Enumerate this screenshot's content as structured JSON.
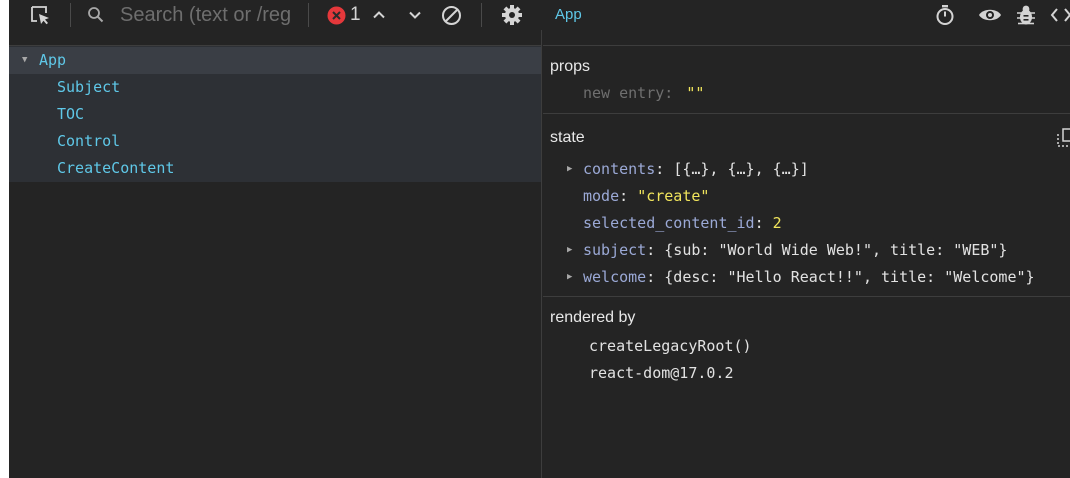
{
  "toolbar": {
    "search_placeholder": "Search (text or /reg",
    "error_count": "1"
  },
  "tree": {
    "items": [
      {
        "label": "App",
        "depth": 0,
        "expanded": true,
        "selected": true
      },
      {
        "label": "Subject",
        "depth": 1
      },
      {
        "label": "TOC",
        "depth": 1
      },
      {
        "label": "Control",
        "depth": 1
      },
      {
        "label": "CreateContent",
        "depth": 1
      }
    ]
  },
  "inspector": {
    "component_name": "App",
    "props": {
      "title": "props",
      "entries": [
        {
          "key": "new entry",
          "value": "\"\""
        }
      ]
    },
    "state": {
      "title": "state",
      "entries": [
        {
          "key": "contents",
          "value": "[{…}, {…}, {…}]",
          "expandable": true
        },
        {
          "key": "mode",
          "value": "\"create\""
        },
        {
          "key": "selected_content_id",
          "value": "2"
        },
        {
          "key": "subject",
          "value": "{sub: \"World Wide Web!\", title: \"WEB\"}",
          "expandable": true
        },
        {
          "key": "welcome",
          "value": "{desc: \"Hello React!!\", title: \"Welcome\"}",
          "expandable": true
        }
      ]
    },
    "rendered_by": {
      "title": "rendered by",
      "items": [
        "createLegacyRoot()",
        "react-dom@17.0.2"
      ]
    }
  },
  "colors": {
    "background": "#242424",
    "tree_bg": "#2d3035",
    "selected_row": "#3a3e45",
    "component": "#5fc8e8",
    "key": "#9ba9d6",
    "string_value": "#f1e55c",
    "error_badge": "#e5383b"
  },
  "icons": [
    "select-element-icon",
    "search-icon",
    "error-icon",
    "chevron-up-icon",
    "chevron-down-icon",
    "clear-icon",
    "settings-gear-icon",
    "timer-icon",
    "eye-icon",
    "bug-icon",
    "code-icon",
    "copy-icon"
  ]
}
